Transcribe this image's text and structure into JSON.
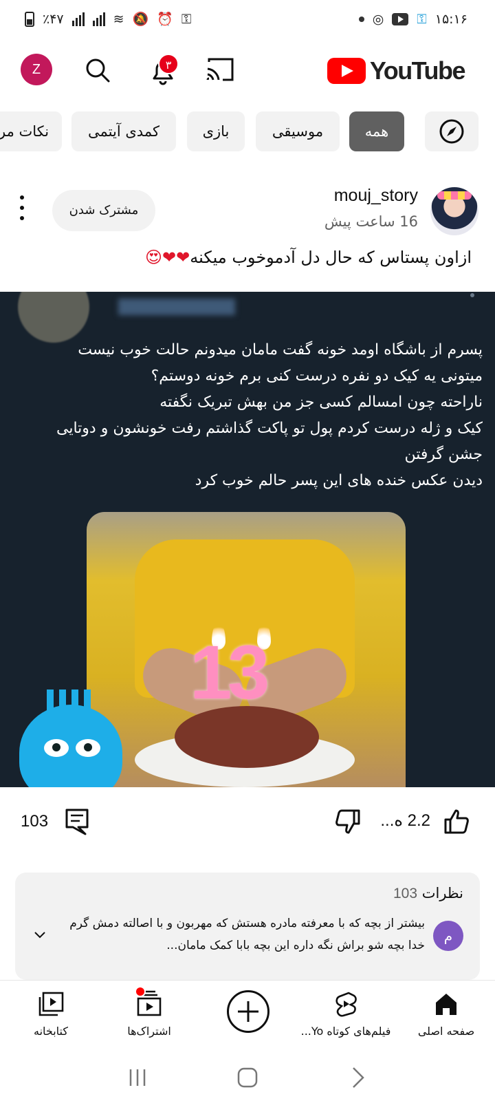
{
  "status_bar": {
    "time": "۱۵:۱۶",
    "battery": "٪۴۷"
  },
  "header": {
    "logo_text": "YouTube",
    "notifications_badge": "۳",
    "avatar_letter": "Z",
    "brand_color": "#ff0000"
  },
  "chips": {
    "explore_icon": "compass-icon",
    "items": [
      "همه",
      "موسیقی",
      "بازی",
      "کمدی آیتمی",
      "نکات مر"
    ],
    "selected": "همه"
  },
  "post": {
    "channel": "mouj_story",
    "time": "16 ساعت پیش",
    "subscribe_label": "مشترک شدن",
    "title": "ازاون پستاس که حال دل آدموخوب میکنه",
    "title_emojis": "❤❤😍",
    "image_text_lines": [
      "پسرم از باشگاه اومد خونه گفت مامان میدونم حالت خوب نیست",
      "میتونی یه کیک دو نفره درست کنی برم خونه دوستم؟",
      "ناراحته چون امسالم کسی جز من بهش تبریک نگفته",
      "کیک و ژله درست کردم پول تو پاکت گذاشتم رفت خونشون و دوتایی",
      "جشن گرفتن",
      "دیدن عکس خنده های این پسر حالم خوب کرد"
    ],
    "candle_number": "13"
  },
  "actions": {
    "likes": "2.2 ه...",
    "comments": "103"
  },
  "comments": {
    "title": "نظرات",
    "count": "103",
    "commenter_initial": "م",
    "top_comment": "بیشتر از بچه که با معرفته مادره هستش که مهربون و با اصالته دمش گرم خدا بچه شو براش نگه داره این بچه بابا کمک مامان..."
  },
  "bottom_nav": {
    "home": "صفحه اصلی",
    "shorts": "فیلم‌های کوتاه Yo...",
    "subscriptions": "اشتراک‌ها",
    "library": "کتابخانه"
  }
}
